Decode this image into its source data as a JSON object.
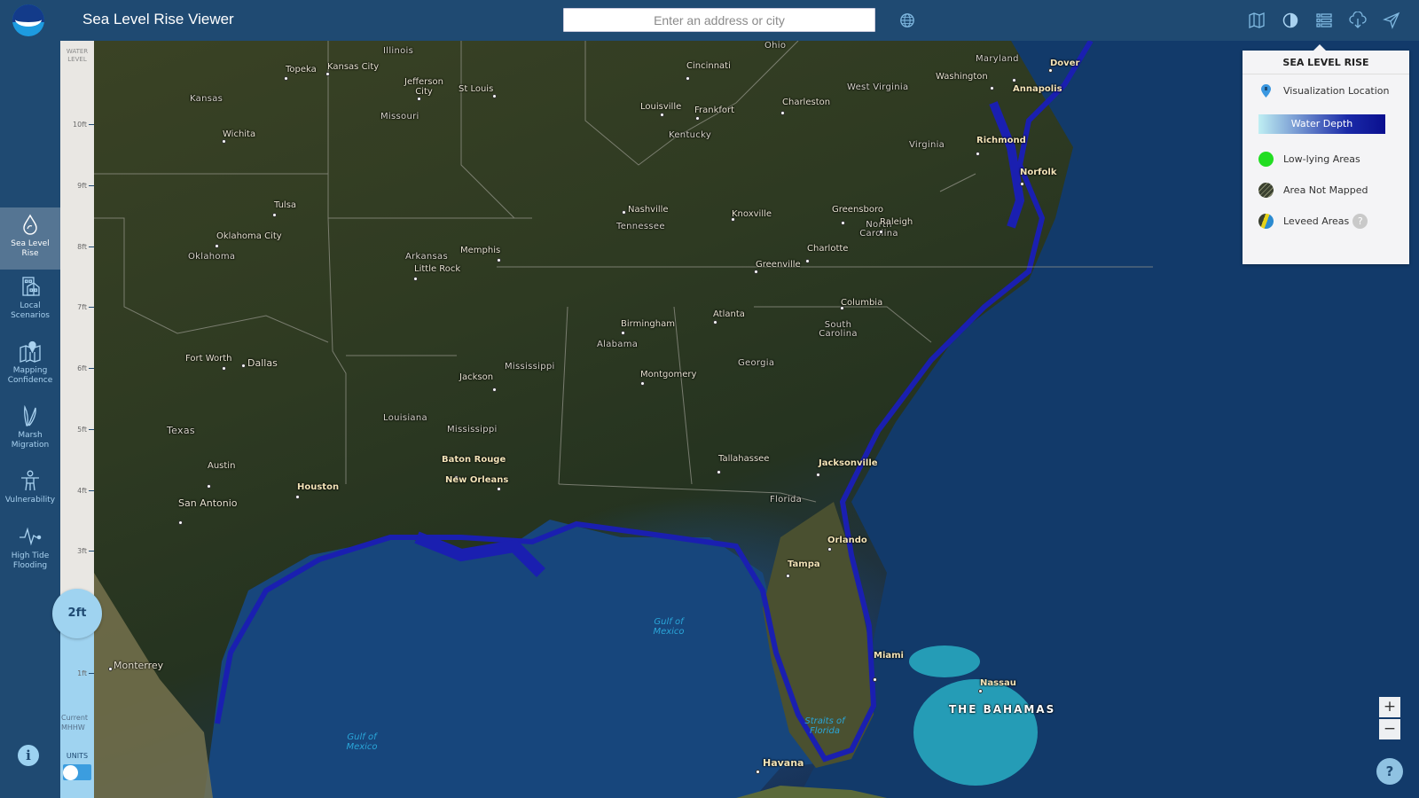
{
  "header": {
    "title": "Sea Level Rise Viewer",
    "search_placeholder": "Enter an address or city",
    "icons": [
      "globe-icon",
      "basemap-icon",
      "contrast-icon",
      "layers-list-icon",
      "download-icon",
      "share-icon"
    ]
  },
  "sidebar": {
    "items": [
      {
        "label_line1": "Sea Level",
        "label_line2": "Rise",
        "icon": "water-drop-icon",
        "active": true
      },
      {
        "label_line1": "Local",
        "label_line2": "Scenarios",
        "icon": "buildings-icon",
        "active": false
      },
      {
        "label_line1": "Mapping",
        "label_line2": "Confidence",
        "icon": "map-pin-icon",
        "active": false
      },
      {
        "label_line1": "Marsh",
        "label_line2": "Migration",
        "icon": "marsh-grass-icon",
        "active": false
      },
      {
        "label_line1": "Vulnerability",
        "label_line2": "",
        "icon": "person-icon",
        "active": false
      },
      {
        "label_line1": "High Tide",
        "label_line2": "Flooding",
        "icon": "pulse-icon",
        "active": false
      }
    ],
    "info_label": "i"
  },
  "water_level": {
    "title_line1": "WATER",
    "title_line2": "LEVEL",
    "ticks": [
      "10ft",
      "9ft",
      "8ft",
      "7ft",
      "6ft",
      "5ft",
      "4ft",
      "3ft",
      "1ft"
    ],
    "current_value": "2ft",
    "current_ft": 2,
    "baseline_line1": "Current",
    "baseline_line2": "MHHW",
    "units_label": "UNITS"
  },
  "legend": {
    "title": "SEA LEVEL RISE",
    "items": [
      {
        "label": "Visualization Location",
        "icon": "location-pin-icon"
      },
      {
        "label": "Water Depth",
        "type": "gradient",
        "colors": [
          "#bfeff3",
          "#0a0f8f"
        ]
      },
      {
        "label": "Low-lying Areas",
        "color": "#22dd22"
      },
      {
        "label": "Area Not Mapped",
        "color": "#3a4030"
      },
      {
        "label": "Leveed Areas",
        "color": "#2a8ad0",
        "help": "?"
      }
    ]
  },
  "map": {
    "states": [
      "Kansas",
      "Missouri",
      "Illinois",
      "Ohio",
      "Kentucky",
      "West Virginia",
      "Virginia",
      "Maryland",
      "Tennessee",
      "North Carolina",
      "South Carolina",
      "Oklahoma",
      "Arkansas",
      "Mississippi",
      "Alabama",
      "Georgia",
      "Louisiana",
      "Texas",
      "Florida"
    ],
    "cities": [
      "Topeka",
      "Kansas City",
      "Jefferson City",
      "St Louis",
      "Wichita",
      "Tulsa",
      "Oklahoma City",
      "Little Rock",
      "Memphis",
      "Louisville",
      "Frankfort",
      "Cincinnati",
      "Charleston",
      "Washington",
      "Annapolis",
      "Dover",
      "Richmond",
      "Norfolk",
      "Nashville",
      "Knoxville",
      "Greensboro",
      "Raleigh",
      "Charlotte",
      "Greenville",
      "Columbia",
      "Atlanta",
      "Birmingham",
      "Montgomery",
      "Jackson",
      "Fort Worth",
      "Dallas",
      "Austin",
      "San Antonio",
      "Houston",
      "Baton Rouge",
      "New Orleans",
      "Tallahassee",
      "Jacksonville",
      "Orlando",
      "Tampa",
      "Miami",
      "Nassau",
      "Havana",
      "Monterrey"
    ],
    "water_labels": {
      "gulf1": "Gulf of Mexico",
      "gulf2": "Gulf of Mexico",
      "straits": "Straits of Florida"
    },
    "country": "THE BAHAMAS"
  },
  "controls": {
    "zoom_in": "+",
    "zoom_out": "−",
    "help": "?"
  }
}
